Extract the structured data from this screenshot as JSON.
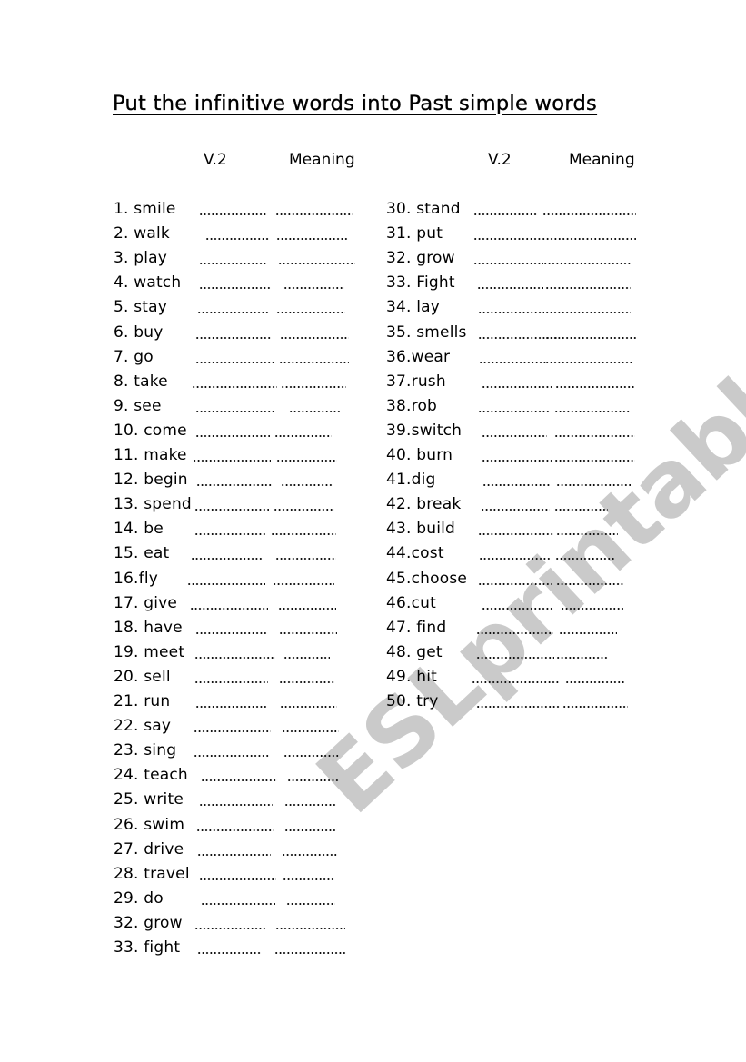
{
  "title": "Put the infinitive words into Past simple words",
  "watermark": "ESLprintables.com",
  "left_column": {
    "header_v2": "V.2",
    "header_meaning": "Meaning",
    "items": [
      "1. smile",
      "2. walk",
      "3. play",
      "4. watch",
      "5. stay",
      "6. buy",
      "7. go",
      "8. take",
      "9. see",
      "10. come",
      "11. make",
      "12. begin",
      "13. spend",
      "14. be",
      "15. eat",
      "16.fly",
      "17. give",
      "18. have",
      "19. meet",
      "20. sell",
      "21. run",
      "22. say",
      "23. sing",
      "24. teach",
      "25. write",
      "26. swim",
      "27. drive",
      "28. travel",
      "29. do",
      "32. grow",
      "33. fight"
    ]
  },
  "right_column": {
    "header_v2": "V.2",
    "header_meaning": "Meaning",
    "items": [
      "30. stand",
      "31. put",
      "32. grow",
      "33. Fight",
      "34. lay",
      "35. smells",
      "36.wear",
      "37.rush",
      "38.rob",
      "39.switch",
      "40. burn",
      "41.dig",
      "42. break",
      "43. build",
      "44.cost",
      "45.choose",
      "46.cut",
      "47. find",
      "48. get",
      "49. hit",
      "50. try"
    ]
  },
  "blank_placeholder": ".................."
}
